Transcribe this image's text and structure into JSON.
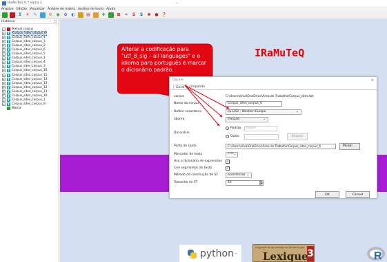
{
  "window": {
    "title": "IRaMuTeQ 0.7 alpha 2"
  },
  "menu": [
    "Arquivo",
    "Edição",
    "Visualizar",
    "Análise de matriz",
    "Análise de texto",
    "Ajuda"
  ],
  "left_panel": {
    "title": "Histórico",
    "controls": "– □",
    "root": "Textual corpus",
    "items": [
      "Corpus_sites_corpus_6",
      "Corpus_sites_corpus_4",
      "Corpus_sites_corpus_3",
      "Corpus_sites_corpus_2",
      "Corpus_sites_corpus_6",
      "Corpus_sites_corpus_5",
      "Corpus_sites_corpus_1",
      "Corpus_sites_corpus_4",
      "Corpus_sites_corpus_3",
      "Corpus_sites_corpus_16",
      "Corpus_sites_corpus_15",
      "Corpus_sites_corpus_14",
      "Corpus_sites_corpus_13",
      "Corpus_sites_corpus_12",
      "Corpus_sites_corpus_11",
      "Corpus_sites_corpus_10",
      "Corpus_sites_corpus_1",
      "Corpus_sites_corpus_9"
    ],
    "last": "Matrix"
  },
  "brand": "IRaMuTeQ",
  "callout": {
    "text": "Alterar a codificação para \"utf_8_sig – all languages\" e o idioma para português e marcar o dicionário padrão.",
    "color": "#e30613"
  },
  "dialog": {
    "title": "Opções",
    "close": "×",
    "tabs": [
      "Geral",
      "Limpando"
    ],
    "fields": {
      "corpus_label": "corpus",
      "corpus_value": "C:\\Users\\silva\\OneDrive\\Área de Trabalho\\Corpus_sites.txt",
      "name_label": "Nome do corpus",
      "name_value": "Corpus_sites_corpus_6",
      "charset_label": "Definir caracteres",
      "charset_value": "cp1252 - Western Europe",
      "language_label": "Idioma",
      "language_value": "français",
      "dictionary_label": "Dicionário",
      "dict_default": "Padrão",
      "dict_default_value": "french",
      "dict_other": "Outro",
      "browse": "Browse",
      "output_label": "Pasta de saída",
      "output_value": "C:\\Users\\silva\\OneDrive\\Área de Trabalho\\Corpus_sites_corpus_6",
      "change": "Mudar ...",
      "marker_label": "Marcador de texto",
      "marker_value": "****",
      "expr_label": "Uso o dicionário de expressões",
      "seg_label": "Crie segmentos de texto",
      "method_label": "Método de construção de ST",
      "method_value": "ocorrências",
      "size_label": "Tamanho de ST",
      "size_value": "40"
    },
    "ok": "OK",
    "cancel": "Cancel"
  },
  "logos": {
    "python": "python",
    "python_tm": "™",
    "lexique": "Lexique",
    "lexique_num": "3",
    "lexique_small": "Un projet de un ouvrage en de lien le pas"
  }
}
